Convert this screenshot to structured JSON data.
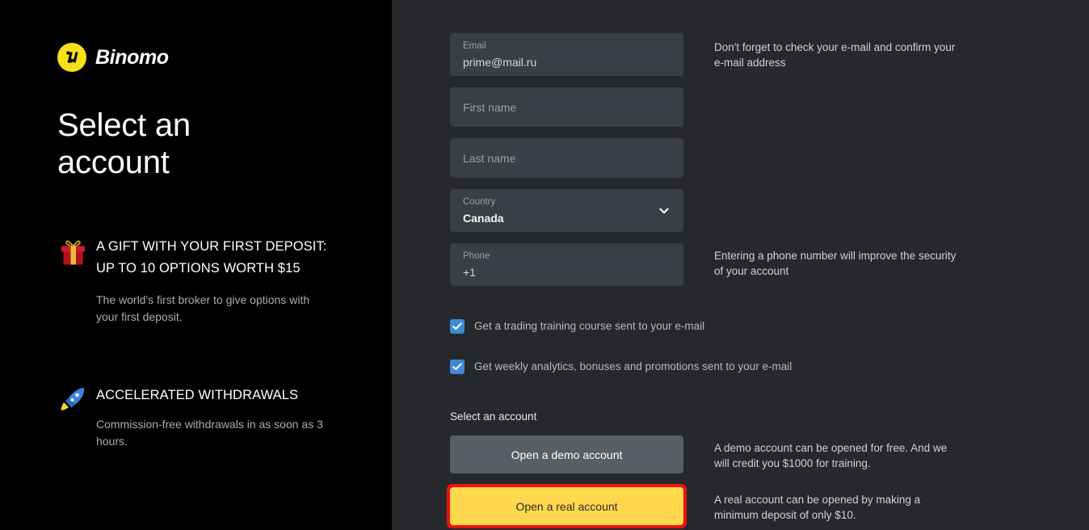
{
  "brand": {
    "name": "Binomo",
    "logo_icon": "binomo-mark-icon",
    "logo_bg": "#f7e01c"
  },
  "left_panel": {
    "headline": "Select an account",
    "benefits": [
      {
        "icon": "gift-icon",
        "title": "A GIFT WITH YOUR FIRST DEPOSIT:\nUP TO 10 OPTIONS WORTH $15",
        "description": "The world's first broker to give options with your first deposit."
      },
      {
        "icon": "rocket-icon",
        "title": "ACCELERATED WITHDRAWALS",
        "description": "Commission-free withdrawals in as soon as 3 hours."
      }
    ]
  },
  "form": {
    "email": {
      "label": "Email",
      "value": "prime@mail.ru"
    },
    "first_name": {
      "placeholder": "First name",
      "value": ""
    },
    "last_name": {
      "placeholder": "Last name",
      "value": ""
    },
    "country": {
      "label": "Country",
      "value": "Canada",
      "chevron_icon": "chevron-down-icon"
    },
    "phone": {
      "label": "Phone",
      "value": "+1"
    },
    "checkboxes": [
      {
        "label": "Get a trading training course sent to your e-mail",
        "checked": true
      },
      {
        "label": "Get weekly analytics, bonuses and promotions sent to your e-mail",
        "checked": true
      }
    ],
    "section_label": "Select an account",
    "demo_button": "Open a demo account",
    "real_button": "Open a real account"
  },
  "helpers": {
    "email": "Don't forget to check your e-mail and confirm your e-mail address",
    "phone": "Entering a phone number will improve the security of your account",
    "demo": "A demo account can be opened for free. And we will credit you $1000 for training.",
    "real": "A real account can be opened by making a minimum deposit of only $10."
  },
  "colors": {
    "accent_yellow": "#ffd84d",
    "checkbox_blue": "#3d8bd8",
    "highlight_red": "#ee1111",
    "panel_bg": "#26282c",
    "field_bg": "#3b3e44",
    "left_bg": "#000000"
  }
}
